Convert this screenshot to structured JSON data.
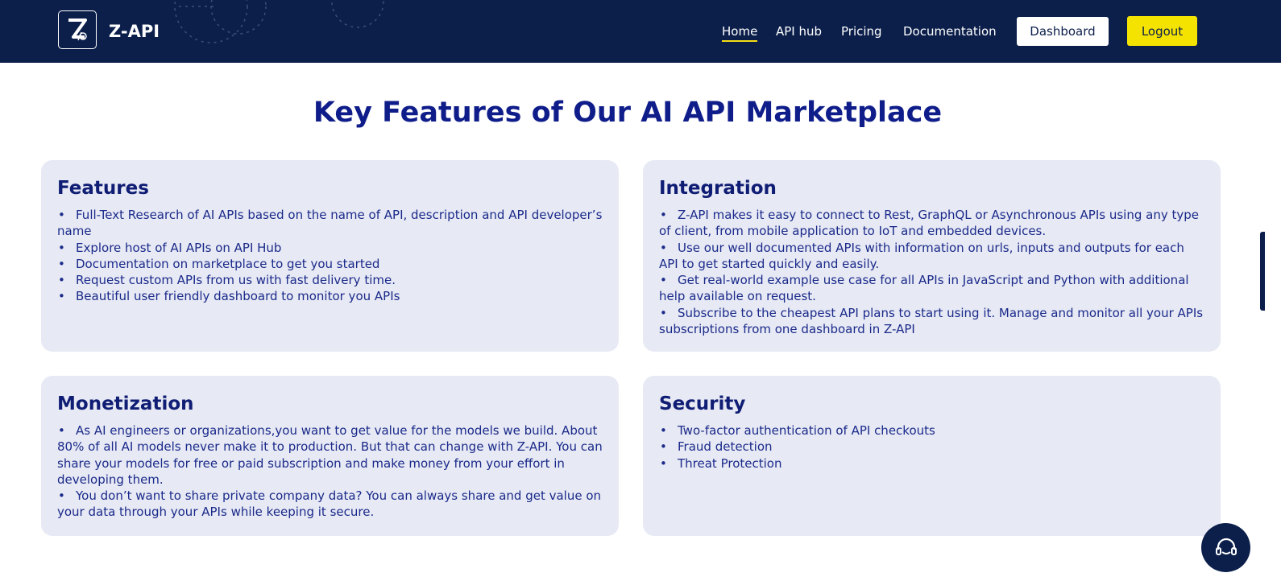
{
  "brand": {
    "name": "Z-API",
    "logo_icon": "z-api-logo-icon"
  },
  "nav": {
    "links": [
      "Home",
      "API hub",
      "Pricing",
      "Documentation"
    ],
    "dashboard_label": "Dashboard",
    "logout_label": "Logout"
  },
  "heading": "Key Features of Our AI API Marketplace",
  "cards": [
    {
      "title": "Features",
      "items": [
        "Full-Text Research of AI APIs based on the name of API, description and API developer’s name",
        "Explore host of AI APIs on API Hub",
        "Documentation on marketplace to get you started",
        "Request custom APIs from us with fast delivery time.",
        "Beautiful user friendly dashboard to monitor you APIs"
      ]
    },
    {
      "title": "Integration",
      "items": [
        "Z-API makes it easy to connect to Rest, GraphQL or Asynchronous APIs using any type of client, from mobile application to IoT and embedded devices.",
        "Use our well documented APIs with information on urls, inputs and outputs for each API to get started quickly and easily.",
        "Get real-world example use case for all APIs in JavaScript and Python with additional help available on request.",
        "Subscribe to the cheapest API plans to start using it. Manage and monitor all your APIs subscriptions from one dashboard in Z-API"
      ]
    },
    {
      "title": "Monetization",
      "items": [
        "As AI engineers or organizations,you want to get value for the models we build. About 80% of all AI models never make it to production. But that can change with Z-API. You can share your models for free or paid subscription and make money from your effort in developing them.",
        "You don’t want to share private company data? You can always share and get value on your data through your APIs while keeping it secure."
      ]
    },
    {
      "title": "Security",
      "items": [
        "Two-factor authentication of API checkouts",
        "Fraud detection",
        "Threat Protection"
      ]
    }
  ],
  "support": {
    "icon": "headset-support-icon"
  },
  "colors": {
    "navbar": "#0c1f4b",
    "accent_yellow": "#f4e300",
    "heading": "#0f1d8a",
    "card_bg": "#e7e9f4"
  }
}
